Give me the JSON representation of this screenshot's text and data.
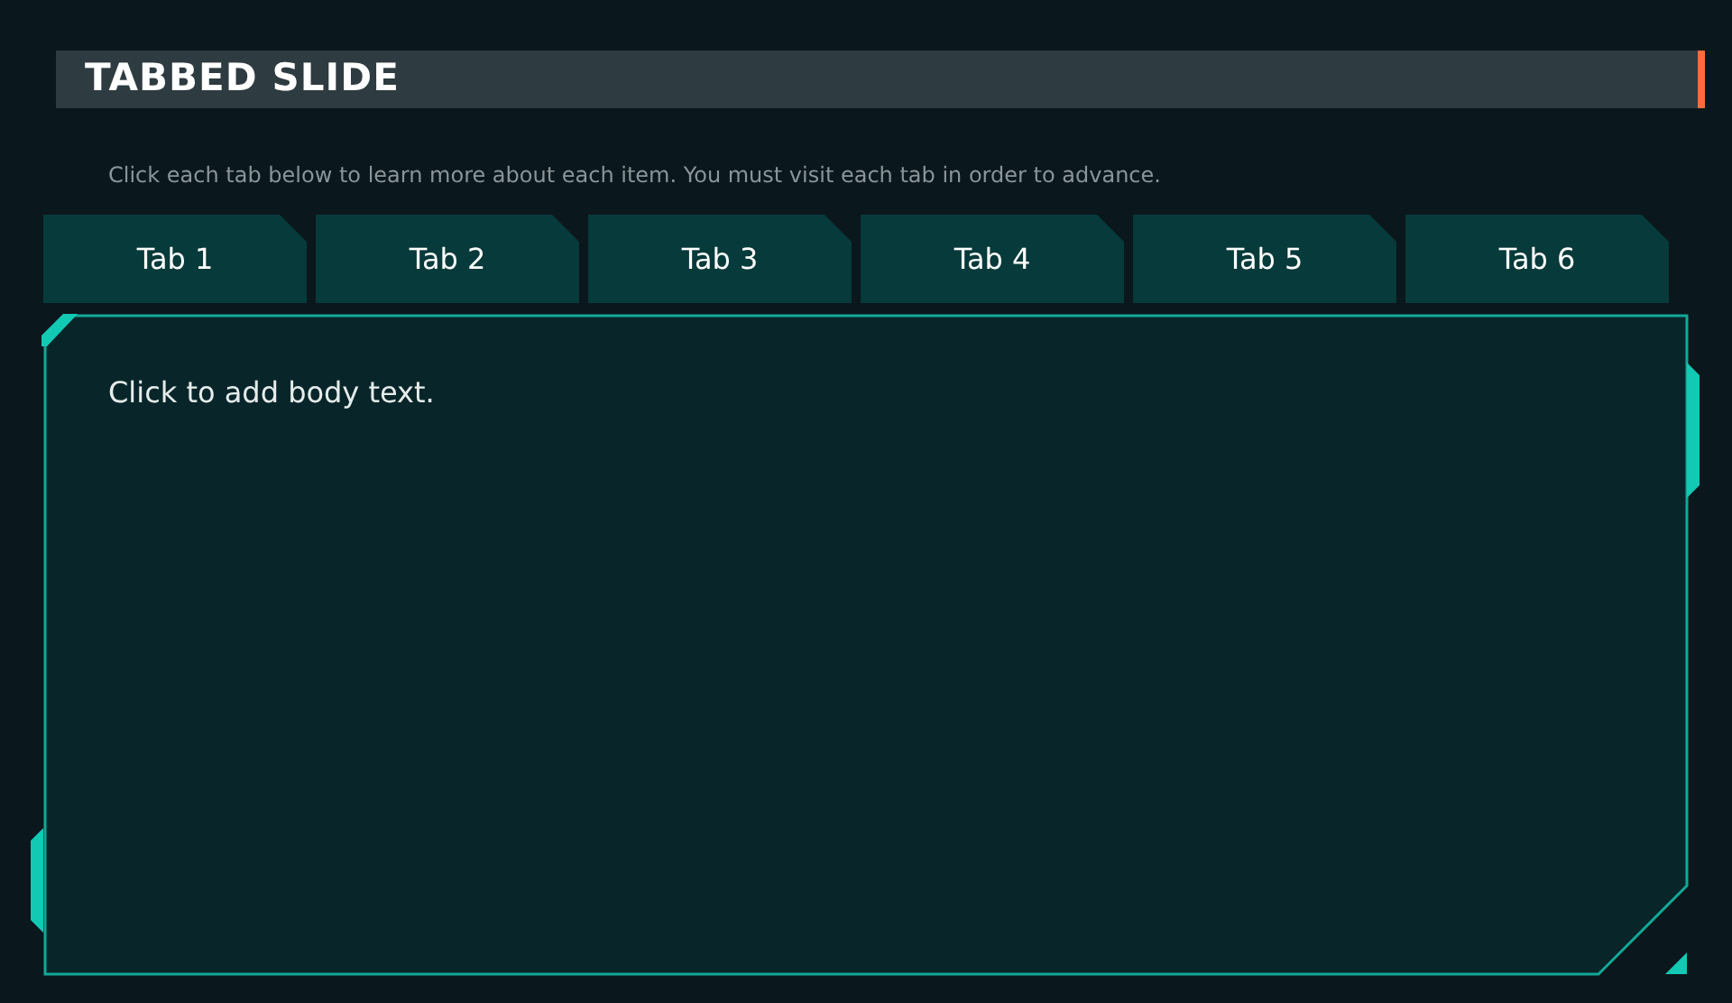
{
  "title": "TABBED SLIDE",
  "instruction": "Click each tab below to learn more about each item. You must visit each tab in order to advance.",
  "tabs": [
    {
      "label": "Tab 1",
      "selected": false
    },
    {
      "label": "Tab 2",
      "selected": false
    },
    {
      "label": "Tab 3",
      "selected": false
    },
    {
      "label": "Tab 4",
      "selected": false
    },
    {
      "label": "Tab 5",
      "selected": false
    },
    {
      "label": "Tab 6",
      "selected": false
    }
  ],
  "body": {
    "placeholder": "Click to add body text."
  }
}
